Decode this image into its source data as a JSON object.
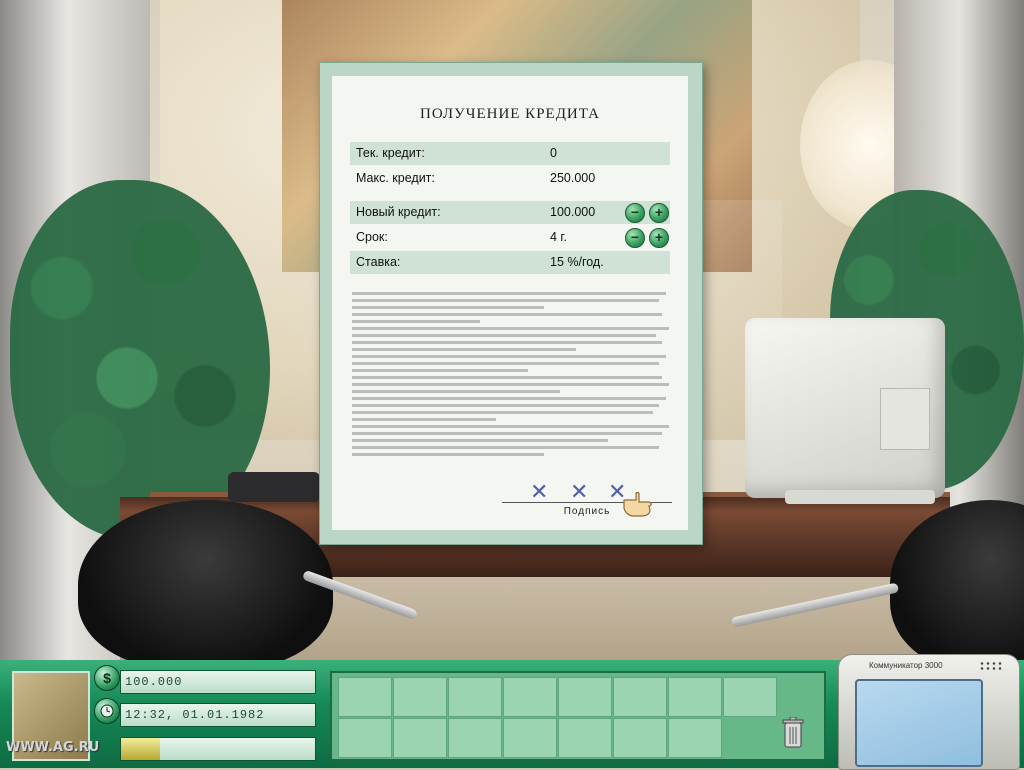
{
  "document": {
    "title": "ПОЛУЧЕНИЕ КРЕДИТА",
    "rows": [
      {
        "label": "Тек. кредит:",
        "value": "0"
      },
      {
        "label": "Макс. кредит:",
        "value": "250.000"
      },
      {
        "label": "Новый кредит:",
        "value": "100.000"
      },
      {
        "label": "Срок:",
        "value": "4 г."
      },
      {
        "label": "Ставка:",
        "value": "15 %/год."
      }
    ],
    "minus_symbol": "−",
    "plus_symbol": "+",
    "signature_mark": "✕",
    "signature_label": "Подпись"
  },
  "hud": {
    "money_icon": "$",
    "money": "100.000",
    "datetime": "12:32, 01.01.1982",
    "progress_fraction": 0.2,
    "communicator_label": "Коммуникатор 3000",
    "watermark": "WWW.AG.RU"
  },
  "icons": {
    "money": "dollar-icon",
    "clock": "clock-icon",
    "trash": "trash-icon",
    "hand": "pointer-hand-icon"
  },
  "colors": {
    "hud_green": "#168a57",
    "doc_border": "#b9d6c6",
    "row_shade": "#cfe2d5",
    "button_green": "#3aa060"
  }
}
